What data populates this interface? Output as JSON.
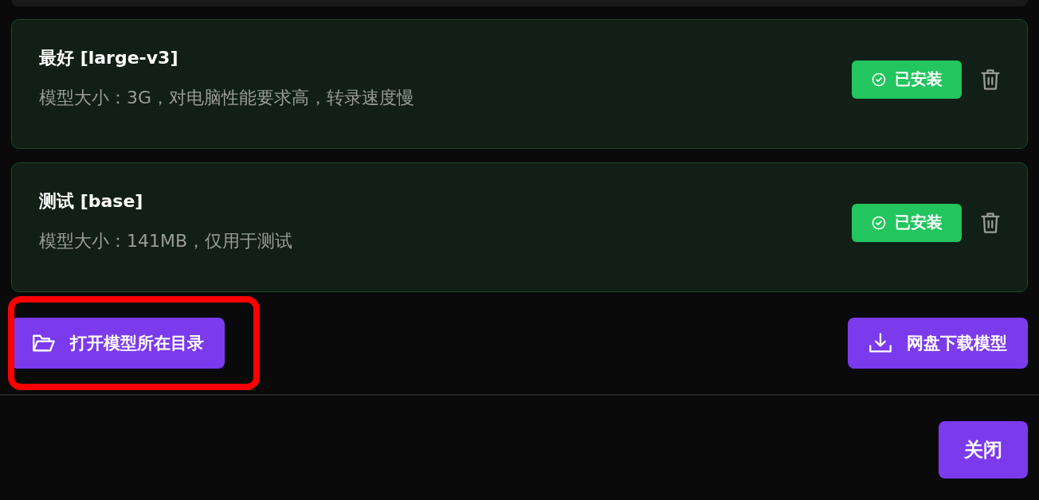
{
  "models": [
    {
      "title": "最好 [large-v3]",
      "description": "模型大小：3G，对电脑性能要求高，转录速度慢",
      "installed": true,
      "status": "已安装"
    },
    {
      "title": "测试 [base]",
      "description": "模型大小：141MB，仅用于测试",
      "installed": true,
      "status": "已安装"
    }
  ],
  "open_folder_button": {
    "label": "打开模型所在目录",
    "highlighted": true
  },
  "download_button": {
    "label": "网盘下载模型"
  },
  "close_button": {
    "label": "关闭"
  }
}
